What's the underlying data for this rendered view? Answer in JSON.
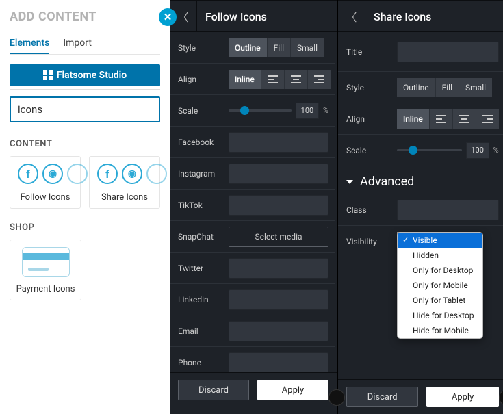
{
  "left": {
    "title": "ADD CONTENT",
    "tabs": {
      "elements": "Elements",
      "import": "Import"
    },
    "studio_btn": "Flatsome Studio",
    "search_value": "icons",
    "sections": {
      "content": {
        "label": "CONTENT",
        "follow": "Follow Icons",
        "share": "Share Icons"
      },
      "shop": {
        "label": "SHOP",
        "payment": "Payment Icons"
      }
    }
  },
  "mid": {
    "title": "Follow Icons",
    "style_label": "Style",
    "style_opts": {
      "outline": "Outline",
      "fill": "Fill",
      "small": "Small"
    },
    "align_label": "Align",
    "align_inline": "Inline",
    "scale_label": "Scale",
    "scale_val": "100",
    "scale_unit": "%",
    "fields": {
      "facebook": "Facebook",
      "instagram": "Instagram",
      "tiktok": "TikTok",
      "snapchat": "SnapChat",
      "select_media": "Select media",
      "twitter": "Twitter",
      "linkedin": "Linkedin",
      "email": "Email",
      "phone": "Phone"
    },
    "discard": "Discard",
    "apply": "Apply"
  },
  "right": {
    "title": "Share Icons",
    "title_label": "Title",
    "style_label": "Style",
    "style_opts": {
      "outline": "Outline",
      "fill": "Fill",
      "small": "Small"
    },
    "align_label": "Align",
    "align_inline": "Inline",
    "scale_label": "Scale",
    "scale_val": "100",
    "scale_unit": "%",
    "advanced": "Advanced",
    "class_label": "Class",
    "visibility_label": "Visibility",
    "vis_opts": {
      "visible": "Visible",
      "hidden": "Hidden",
      "desktop": "Only for Desktop",
      "mobile": "Only for Mobile",
      "tablet": "Only for Tablet",
      "hide_desktop": "Hide for Desktop",
      "hide_mobile": "Hide for Mobile"
    },
    "discard": "Discard",
    "apply": "Apply"
  }
}
